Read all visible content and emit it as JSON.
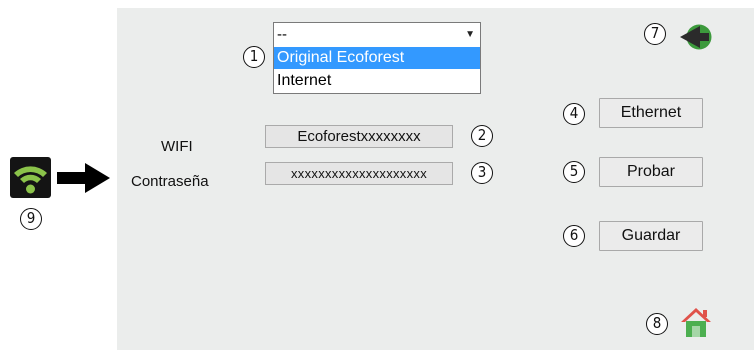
{
  "selector": {
    "selected": "--",
    "options": [
      "Original Ecoforest",
      "Internet"
    ],
    "highlighted_index": 0
  },
  "wifi": {
    "label": "WIFI",
    "value": "Ecoforestxxxxxxxx"
  },
  "password": {
    "label": "Contraseña",
    "value": "xxxxxxxxxxxxxxxxxxxx"
  },
  "buttons": {
    "ethernet": "Ethernet",
    "probar": "Probar",
    "guardar": "Guardar"
  },
  "markers": [
    "1",
    "2",
    "3",
    "4",
    "5",
    "6",
    "7",
    "8",
    "9"
  ],
  "colors": {
    "panel_bg": "#ebedec",
    "highlight": "#3399ff",
    "wifi_green": "#8bc34a",
    "back_green": "#3c9a3c",
    "house_roof": "#e0524a"
  }
}
